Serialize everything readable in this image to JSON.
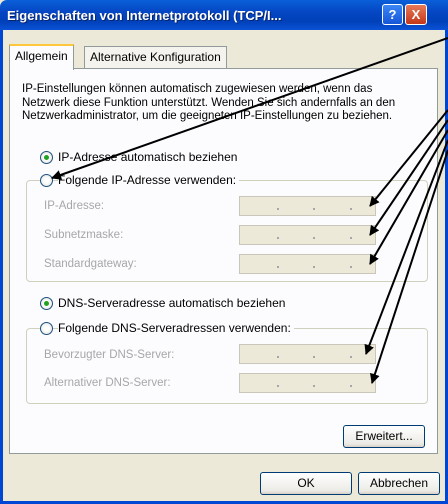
{
  "window": {
    "title": "Eigenschaften von Internetprotokoll (TCP/I...",
    "help_label": "?",
    "close_label": "X"
  },
  "tabs": [
    {
      "label": "Allgemein",
      "active": true
    },
    {
      "label": "Alternative Konfiguration",
      "active": false
    }
  ],
  "general": {
    "description": "IP-Einstellungen können automatisch zugewiesen werden, wenn das Netzwerk diese Funktion unterstützt. Wenden Sie sich andernfalls an den Netzwerkadministrator, um die geeigneten IP-Einstellungen zu beziehen.",
    "ip_auto_label": "IP-Adresse automatisch beziehen",
    "ip_manual_label": "Folgende IP-Adresse verwenden:",
    "ip_mode_selected": "automatic",
    "ip_fields": [
      {
        "label": "IP-Adresse:",
        "value": ""
      },
      {
        "label": "Subnetzmaske:",
        "value": ""
      },
      {
        "label": "Standardgateway:",
        "value": ""
      }
    ],
    "dns_auto_label": "DNS-Serveradresse automatisch beziehen",
    "dns_manual_label": "Folgende DNS-Serveradressen verwenden:",
    "dns_mode_selected": "automatic",
    "dns_fields": [
      {
        "label": "Bevorzugter DNS-Server:",
        "value": ""
      },
      {
        "label": "Alternativer DNS-Server:",
        "value": ""
      }
    ],
    "advanced_label": "Erweitert..."
  },
  "footer": {
    "ok_label": "OK",
    "cancel_label": "Abbrechen"
  },
  "colors": {
    "titlebar": "#0046d5",
    "dialog_bg": "#ece9d8",
    "panel_bg": "#fcfcfe",
    "radio_selected": "#21a121",
    "annotation_arrow": "#000000"
  }
}
